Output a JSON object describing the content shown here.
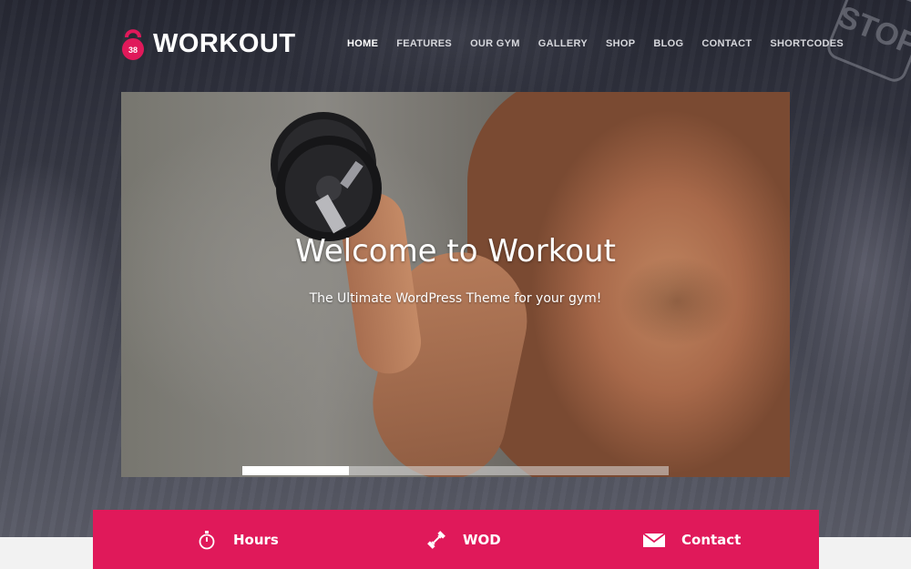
{
  "brand": {
    "name": "WORKOUT",
    "accent": "#e0195a"
  },
  "nav": {
    "items": [
      {
        "label": "HOME",
        "active": true
      },
      {
        "label": "FEATURES",
        "active": false
      },
      {
        "label": "OUR GYM",
        "active": false
      },
      {
        "label": "GALLERY",
        "active": false
      },
      {
        "label": "SHOP",
        "active": false
      },
      {
        "label": "BLOG",
        "active": false
      },
      {
        "label": "CONTACT",
        "active": false
      },
      {
        "label": "SHORTCODES",
        "active": false
      }
    ]
  },
  "background": {
    "sign_text": "STOP"
  },
  "hero": {
    "title": "Welcome to Workout",
    "subtitle": "The Ultimate WordPress Theme for your gym!",
    "slides_count": 4,
    "active_slide": 1
  },
  "features": [
    {
      "label": "Hours",
      "icon": "stopwatch-icon"
    },
    {
      "label": "WOD",
      "icon": "dumbbell-icon"
    },
    {
      "label": "Contact",
      "icon": "envelope-icon"
    }
  ]
}
